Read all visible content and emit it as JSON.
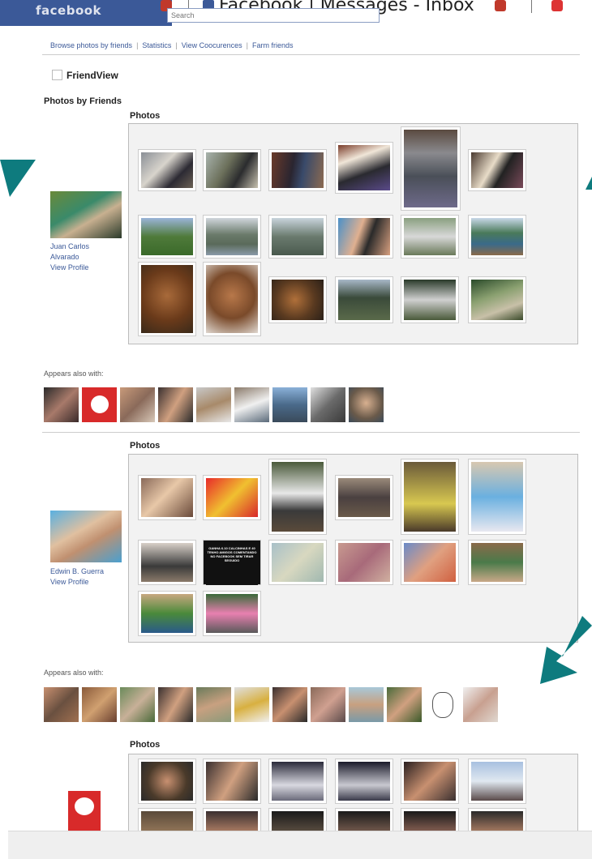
{
  "browser": {
    "tab_title": "Facebook | Messages - Inbox",
    "search_placeholder": "Search",
    "logo_text": "facebook"
  },
  "subnav": {
    "items": [
      "Browse photos by friends",
      "Statistics",
      "View Coocurences",
      "Farm friends"
    ]
  },
  "app": {
    "title": "FriendView",
    "section_title": "Photos by Friends"
  },
  "friends": [
    {
      "name_line1": "Juan Carlos",
      "name_line2": "Alvarado",
      "view_profile": "View Profile",
      "photos_label": "Photos",
      "appears_label": "Appears also with:"
    },
    {
      "name_line1": "Edwin B. Guerra",
      "view_profile": "View Profile",
      "photos_label": "Photos",
      "appears_label": "Appears also with:"
    },
    {
      "photos_label": "Photos"
    }
  ],
  "meme_text": "GANHA 6.10 CALCINHAS E 40 TENHO AMIGOS COMENTANDO NO FACEBOOK SEM TIRAR SEGUIDO",
  "colors": {
    "brand": "#3b5998",
    "arrow": "#0e7b7e",
    "panel_bg": "#f2f2f2"
  },
  "icons": [
    "checkbox-icon",
    "arrow-icon",
    "close-tab-icon",
    "facebook-favicon"
  ]
}
